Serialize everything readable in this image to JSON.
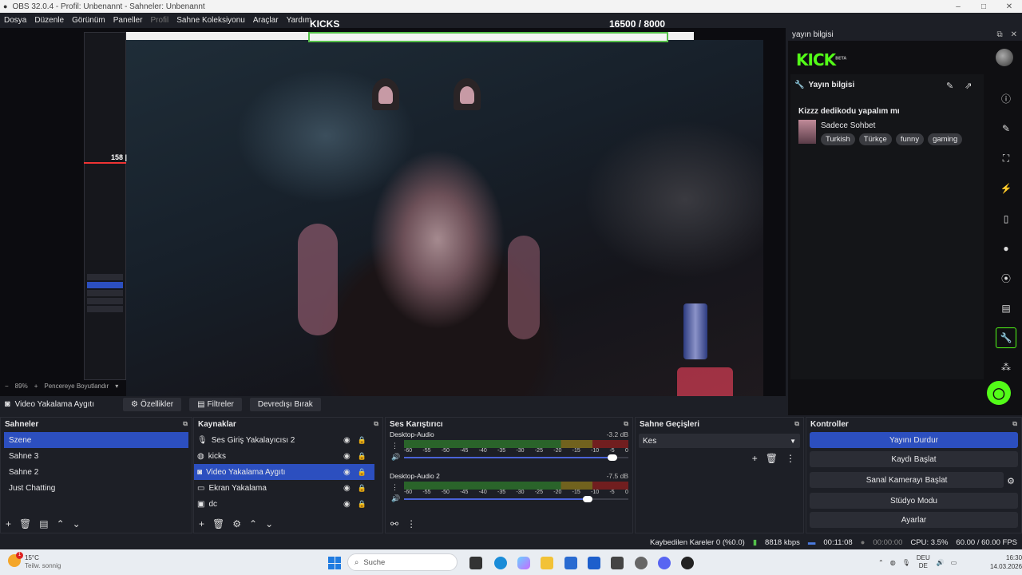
{
  "window": {
    "title": "OBS 32.0.4 - Profil: Unbenannt - Sahneler: Unbenannt",
    "min": "–",
    "max": "□",
    "close": "✕"
  },
  "menu": [
    "Dosya",
    "Düzenle",
    "Görünüm",
    "Paneller",
    "Profil",
    "Sahne Koleksiyonu",
    "Araçlar",
    "Yardım"
  ],
  "overlay": {
    "kicks_label": "KICKS",
    "kicks_count": "16500  / 8000",
    "red_value": "158 |"
  },
  "preview_status": {
    "zoom": "89%",
    "mode": "Pencereye Boyutlandır"
  },
  "source_toolbar": {
    "source": "Video Yakalama Aygıtı",
    "properties": "Özellikler",
    "filters": "Filtreler",
    "deactivate": "Devredışı Bırak"
  },
  "dock": {
    "header": "yayın bilgisi",
    "logo": "KICK",
    "logo_badge": "BETA",
    "panel_title": "Yayın bilgisi",
    "stream_title": "Kizzz dedikodu yapalım mı",
    "category": "Sadece Sohbet",
    "tags": [
      "Turkish",
      "Türkçe",
      "funny",
      "gaming"
    ],
    "side_icons": [
      "info-icon",
      "pencil-icon",
      "capture-icon",
      "bolt-icon",
      "clipboard-icon",
      "chat-icon",
      "broadcast-icon",
      "printer-icon",
      "wrench-icon",
      "share-icon"
    ],
    "brand_color": "#53fc18"
  },
  "scenes": {
    "title": "Sahneler",
    "items": [
      "Szene",
      "Sahne 3",
      "Sahne 2",
      "Just Chatting"
    ],
    "selected": 0
  },
  "sources": {
    "title": "Kaynaklar",
    "items": [
      {
        "name": "Ses Giriş Yakalayıcısı 2",
        "icon": "mic-icon"
      },
      {
        "name": "kicks",
        "icon": "globe-icon"
      },
      {
        "name": "Video Yakalama Aygıtı",
        "icon": "camera-icon"
      },
      {
        "name": "Ekran Yakalama",
        "icon": "monitor-icon"
      },
      {
        "name": "dc",
        "icon": "window-icon"
      }
    ],
    "selected": 2
  },
  "mixer": {
    "title": "Ses Karıştırıcı",
    "channels": [
      {
        "name": "Desktop-Audio",
        "db": "-3.2 dB",
        "level": 0.93
      },
      {
        "name": "Desktop-Audio 2",
        "db": "-7.5 dB",
        "level": 0.82
      }
    ],
    "scale": [
      "-60",
      "-55",
      "-50",
      "-45",
      "-40",
      "-35",
      "-30",
      "-25",
      "-20",
      "-15",
      "-10",
      "-5",
      "0"
    ]
  },
  "transitions": {
    "title": "Sahne Geçişleri",
    "selected": "Kes"
  },
  "controls": {
    "title": "Kontroller",
    "buttons": [
      "Yayını Durdur",
      "Kaydı Başlat",
      "Sanal Kamerayı Başlat",
      "Stüdyo Modu",
      "Ayarlar"
    ]
  },
  "status": {
    "dropped": "Kaybedilen Kareler 0 (%0.0)",
    "bitrate": "8818 kbps",
    "stream_time": "00:11:08",
    "rec_time": "00:00:00",
    "cpu": "CPU: 3.5%",
    "fps": "60.00 / 60.00 FPS"
  },
  "taskbar": {
    "weather_temp": "15°C",
    "weather_desc": "Teilw. sonnig",
    "weather_badge": "1",
    "search": "Suche",
    "lang1": "DEU",
    "lang2": "DE",
    "time": "16:30",
    "date": "14.03.2026"
  }
}
